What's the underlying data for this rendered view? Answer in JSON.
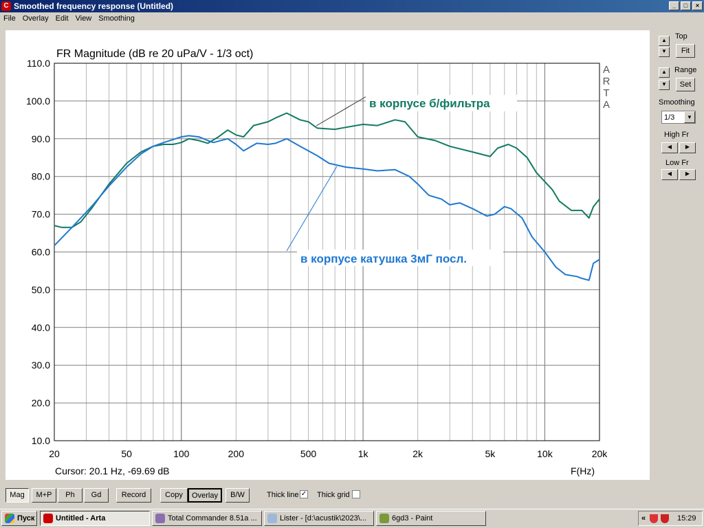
{
  "window": {
    "title": "Smoothed frequency response (Untitled)",
    "controls": [
      "_",
      "□",
      "×"
    ]
  },
  "menu": [
    "File",
    "Overlay",
    "Edit",
    "View",
    "Smoothing"
  ],
  "chart_data": {
    "type": "line",
    "title": "FR Magnitude (dB re 20 uPa/V - 1/3 oct)",
    "xlabel": "F(Hz)",
    "ylabel": "",
    "xscale": "log",
    "xlim": [
      20,
      20000
    ],
    "ylim": [
      10,
      110
    ],
    "x_ticks": [
      20,
      50,
      100,
      200,
      500,
      1000,
      2000,
      5000,
      10000,
      20000
    ],
    "x_tick_labels": [
      "20",
      "50",
      "100",
      "200",
      "500",
      "1k",
      "2k",
      "5k",
      "10k",
      "20k"
    ],
    "y_ticks": [
      110,
      100,
      90,
      80,
      70,
      60,
      50,
      40,
      30,
      20,
      10
    ],
    "y_tick_labels": [
      "110.0",
      "100.0",
      "90.0",
      "80.0",
      "70.0",
      "60.0",
      "50.0",
      "40.0",
      "30.0",
      "20.0",
      "10.0"
    ],
    "grid": true,
    "watermark": "ARTA",
    "series": [
      {
        "name": "в корпусе б/фильтра",
        "color": "#127a62",
        "points": [
          [
            20,
            67
          ],
          [
            22,
            66.5
          ],
          [
            25,
            66.5
          ],
          [
            28,
            68
          ],
          [
            32,
            71.5
          ],
          [
            40,
            78
          ],
          [
            50,
            83.5
          ],
          [
            60,
            86.5
          ],
          [
            70,
            88
          ],
          [
            80,
            88.5
          ],
          [
            90,
            88.5
          ],
          [
            100,
            89
          ],
          [
            110,
            90
          ],
          [
            125,
            89.5
          ],
          [
            140,
            88.8
          ],
          [
            160,
            90.5
          ],
          [
            180,
            92.3
          ],
          [
            200,
            91
          ],
          [
            220,
            90.5
          ],
          [
            250,
            93.5
          ],
          [
            300,
            94.5
          ],
          [
            330,
            95.5
          ],
          [
            380,
            96.8
          ],
          [
            450,
            95
          ],
          [
            500,
            94.5
          ],
          [
            560,
            92.8
          ],
          [
            700,
            92.5
          ],
          [
            800,
            93
          ],
          [
            1000,
            93.8
          ],
          [
            1200,
            93.5
          ],
          [
            1500,
            95
          ],
          [
            1700,
            94.5
          ],
          [
            2000,
            90.5
          ],
          [
            2500,
            89.5
          ],
          [
            3000,
            88
          ],
          [
            4000,
            86.5
          ],
          [
            5000,
            85.3
          ],
          [
            5500,
            87.5
          ],
          [
            6300,
            88.5
          ],
          [
            7000,
            87.5
          ],
          [
            8000,
            85
          ],
          [
            9000,
            81
          ],
          [
            11000,
            76.5
          ],
          [
            12000,
            73.5
          ],
          [
            14000,
            71
          ],
          [
            16000,
            71
          ],
          [
            17500,
            69
          ],
          [
            18500,
            72
          ],
          [
            20000,
            74
          ]
        ]
      },
      {
        "name": "в корпусе катушка 3мГ посл.",
        "color": "#1f78d0",
        "points": [
          [
            20,
            61.7
          ],
          [
            25,
            66.5
          ],
          [
            32,
            72
          ],
          [
            40,
            77.5
          ],
          [
            50,
            82.5
          ],
          [
            60,
            86
          ],
          [
            70,
            88
          ],
          [
            80,
            89
          ],
          [
            100,
            90.5
          ],
          [
            110,
            90.8
          ],
          [
            125,
            90.5
          ],
          [
            140,
            89.5
          ],
          [
            150,
            89
          ],
          [
            180,
            90
          ],
          [
            200,
            88.5
          ],
          [
            220,
            86.8
          ],
          [
            260,
            88.8
          ],
          [
            300,
            88.5
          ],
          [
            330,
            88.8
          ],
          [
            380,
            90
          ],
          [
            450,
            88
          ],
          [
            560,
            85.5
          ],
          [
            650,
            83.5
          ],
          [
            800,
            82.5
          ],
          [
            1000,
            82
          ],
          [
            1200,
            81.5
          ],
          [
            1500,
            81.8
          ],
          [
            1800,
            80
          ],
          [
            2000,
            78
          ],
          [
            2300,
            75
          ],
          [
            2700,
            74
          ],
          [
            3000,
            72.5
          ],
          [
            3400,
            73
          ],
          [
            4000,
            71.5
          ],
          [
            4800,
            69.5
          ],
          [
            5300,
            70
          ],
          [
            6000,
            72
          ],
          [
            6500,
            71.5
          ],
          [
            7500,
            69
          ],
          [
            8500,
            64
          ],
          [
            10000,
            60
          ],
          [
            11500,
            56
          ],
          [
            13000,
            54
          ],
          [
            15000,
            53.5
          ],
          [
            16000,
            53
          ],
          [
            17500,
            52.5
          ],
          [
            18500,
            57
          ],
          [
            20000,
            58
          ]
        ]
      }
    ],
    "annotations": [
      {
        "text": "в корпусе б/фильтра",
        "color": "#127a62"
      },
      {
        "text": "в корпусе катушка 3мГ посл.",
        "color": "#1f78d0"
      }
    ],
    "cursor_readout": "Cursor: 20.1 Hz, -69.69 dB"
  },
  "right_panel": {
    "top_label": "Top",
    "fit": "Fit",
    "range_label": "Range",
    "set": "Set",
    "smoothing_label": "Smoothing",
    "smoothing_value": "1/3",
    "high_fr": "High Fr",
    "low_fr": "Low Fr"
  },
  "toolbar": {
    "buttons": [
      "Mag",
      "M+P",
      "Ph",
      "Gd",
      "Record",
      "Copy",
      "Overlay",
      "B/W"
    ],
    "thick_line": "Thick line",
    "thick_line_checked": true,
    "thick_grid": "Thick grid",
    "thick_grid_checked": false
  },
  "taskbar": {
    "start": "Пуск",
    "tasks": [
      "Untitled - Arta",
      "Total Commander 8.51a ...",
      "Lister - [d:\\acustik\\2023\\...",
      "6gd3 - Paint"
    ],
    "clock": "15:29"
  }
}
